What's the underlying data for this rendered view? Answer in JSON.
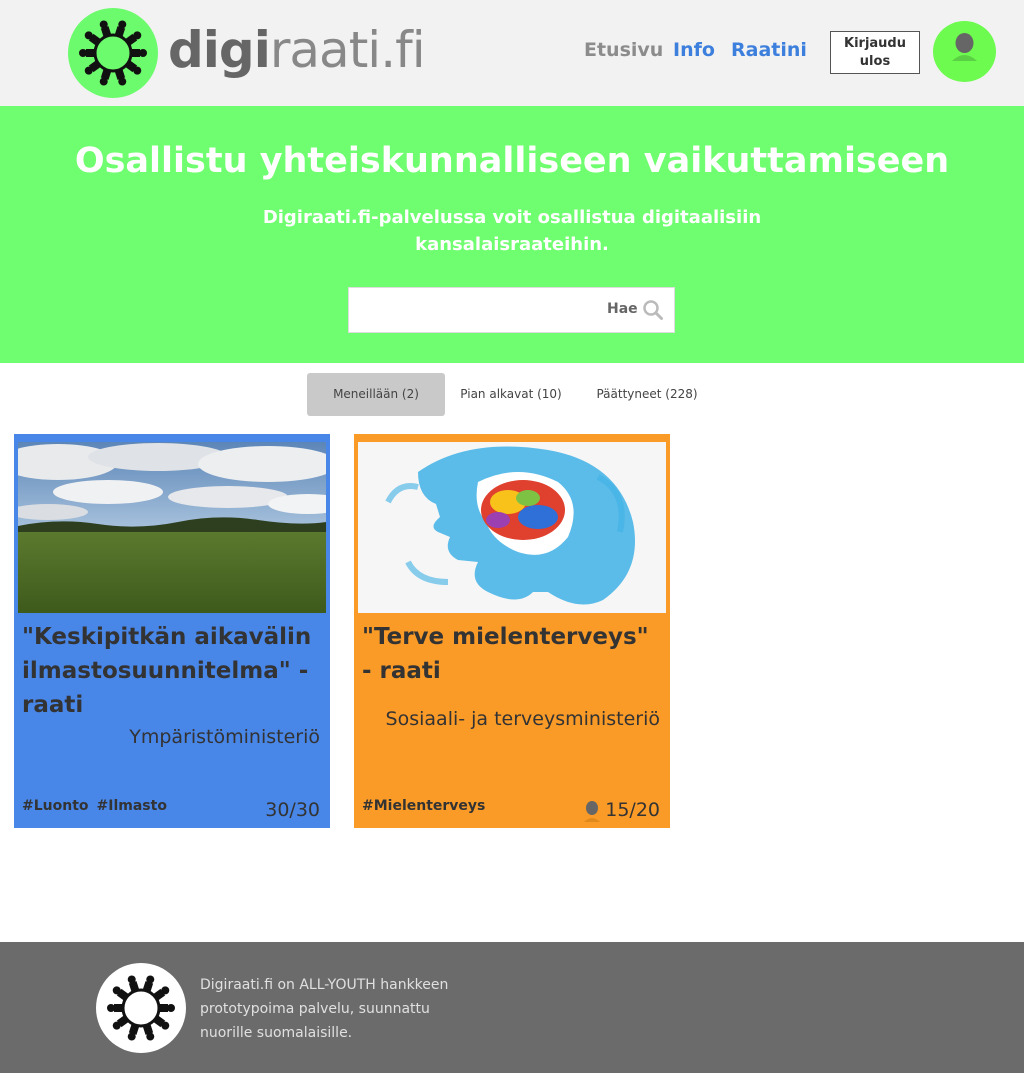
{
  "header": {
    "logo_bold": "digi",
    "logo_light": "raati.fi",
    "nav": {
      "home": "Etusivu",
      "info": "Info",
      "my": "Raatini"
    },
    "logout_line1": "Kirjaudu",
    "logout_line2": "ulos"
  },
  "hero": {
    "title": "Osallistu yhteiskunnalliseen vaikuttamiseen",
    "subtitle": "Digiraati.fi-palvelussa voit osallistua digitaalisiin kansalaisraateihin.",
    "search_button": "Hae",
    "search_value": ""
  },
  "tabs": [
    {
      "label": "Meneillään (2)",
      "active": true
    },
    {
      "label": "Pian alkavat (10)",
      "active": false
    },
    {
      "label": "Päättyneet (228)",
      "active": false
    }
  ],
  "cards": [
    {
      "title": "\"Keskipitkän aikavälin ilmastosuunnitelma\" - raati",
      "organizer": "Ympäristöministeriö",
      "tags": [
        "#Luonto",
        "#Ilmasto"
      ],
      "participants": "30/30",
      "color": "#4886e8"
    },
    {
      "title": "\"Terve mielenterveys\" - raati",
      "organizer": "Sosiaali- ja terveysministeriö",
      "tags": [
        "#Mielenterveys"
      ],
      "participants": "15/20",
      "color": "#fa9b28"
    }
  ],
  "footer": {
    "text": "Digiraati.fi on ALL-YOUTH hankkeen prototypoima palvelu, suunnattu nuorille suomalaisille."
  },
  "colors": {
    "hero_green": "#6ffe6f",
    "link_blue": "#3d7fdc",
    "footer_gray": "#6b6b6b"
  }
}
